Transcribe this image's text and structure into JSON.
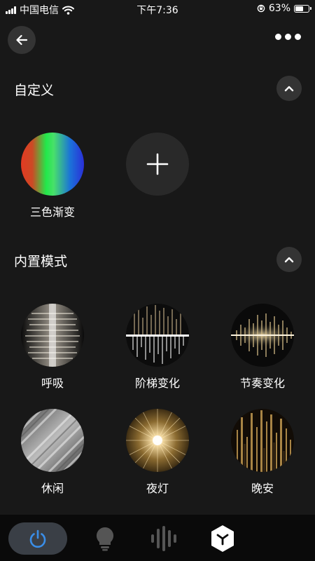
{
  "status_bar": {
    "carrier": "中国电信",
    "time": "下午7:36",
    "battery_percent": "63%",
    "battery_level": 0.63,
    "icons": [
      "signal-icon",
      "wifi-icon",
      "orientation-lock-icon",
      "battery-icon"
    ]
  },
  "header": {
    "back_icon": "arrow-left-icon",
    "more_icon": "more-horizontal-icon"
  },
  "custom_section": {
    "title": "自定义",
    "collapse_icon": "chevron-up-icon",
    "items": [
      {
        "label": "三色渐变",
        "colors": [
          "#e33a22",
          "#22e84a",
          "#2a2fd8"
        ]
      }
    ],
    "add_icon": "plus-icon"
  },
  "builtin_section": {
    "title": "内置模式",
    "collapse_icon": "chevron-up-icon",
    "items": [
      {
        "label": "呼吸"
      },
      {
        "label": "阶梯变化"
      },
      {
        "label": "节奏变化"
      },
      {
        "label": "休闲"
      },
      {
        "label": "夜灯"
      },
      {
        "label": "晚安"
      }
    ]
  },
  "tab_bar": {
    "tabs": [
      {
        "icon": "power-icon",
        "active": true
      },
      {
        "icon": "bulb-icon",
        "active": false
      },
      {
        "icon": "sound-wave-icon",
        "active": false
      },
      {
        "icon": "hexagon-logo-icon",
        "active": false
      }
    ],
    "accent": "#3a8ee8"
  }
}
